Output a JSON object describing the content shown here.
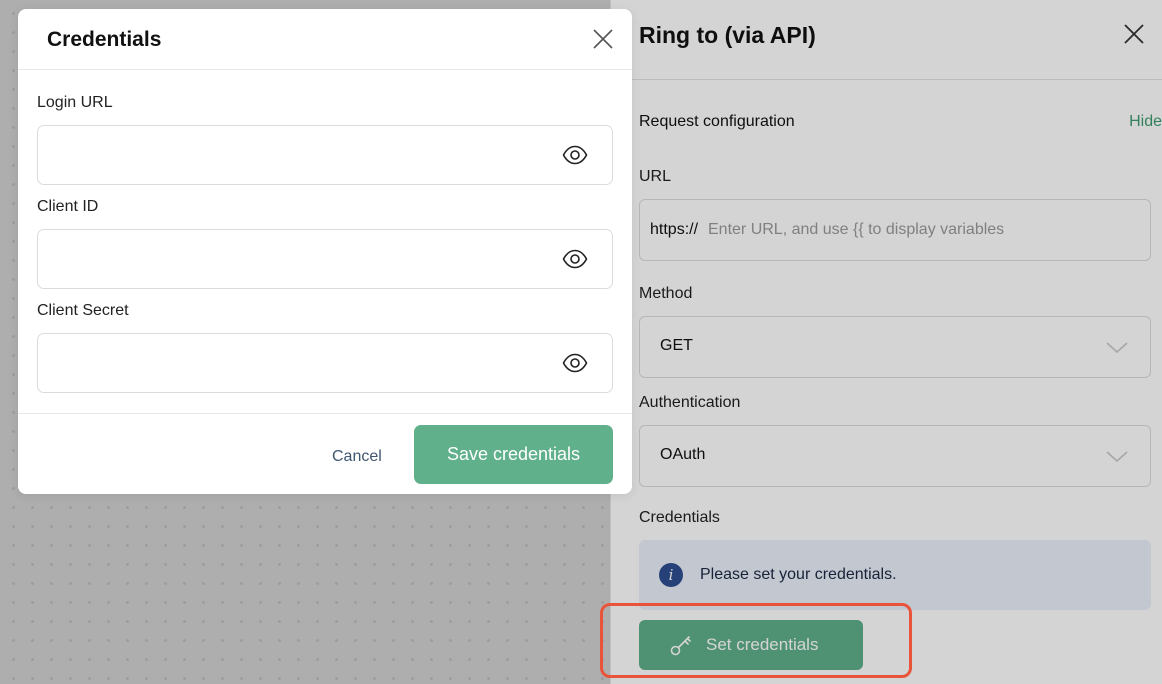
{
  "modal": {
    "title": "Credentials",
    "fields": [
      {
        "label": "Login URL",
        "value": ""
      },
      {
        "label": "Client ID",
        "value": ""
      },
      {
        "label": "Client Secret",
        "value": ""
      }
    ],
    "cancel_label": "Cancel",
    "save_label": "Save credentials"
  },
  "panel": {
    "title": "Ring to (via API)",
    "section_title": "Request configuration",
    "hide_label": "Hide",
    "url": {
      "label": "URL",
      "prefix": "https://",
      "placeholder": "Enter URL, and use {{ to display variables"
    },
    "method": {
      "label": "Method",
      "value": "GET"
    },
    "authentication": {
      "label": "Authentication",
      "value": "OAuth"
    },
    "credentials": {
      "label": "Credentials",
      "info_text": "Please set your credentials.",
      "button_label": "Set credentials"
    }
  },
  "colors": {
    "accent_green": "#5fb08b",
    "link_green": "#3f9c72",
    "highlight_red": "#e8533a",
    "info_bg": "#eaf0fb"
  },
  "icons": [
    "close-icon",
    "eye-icon",
    "chevron-down-icon",
    "info-icon",
    "key-icon"
  ]
}
